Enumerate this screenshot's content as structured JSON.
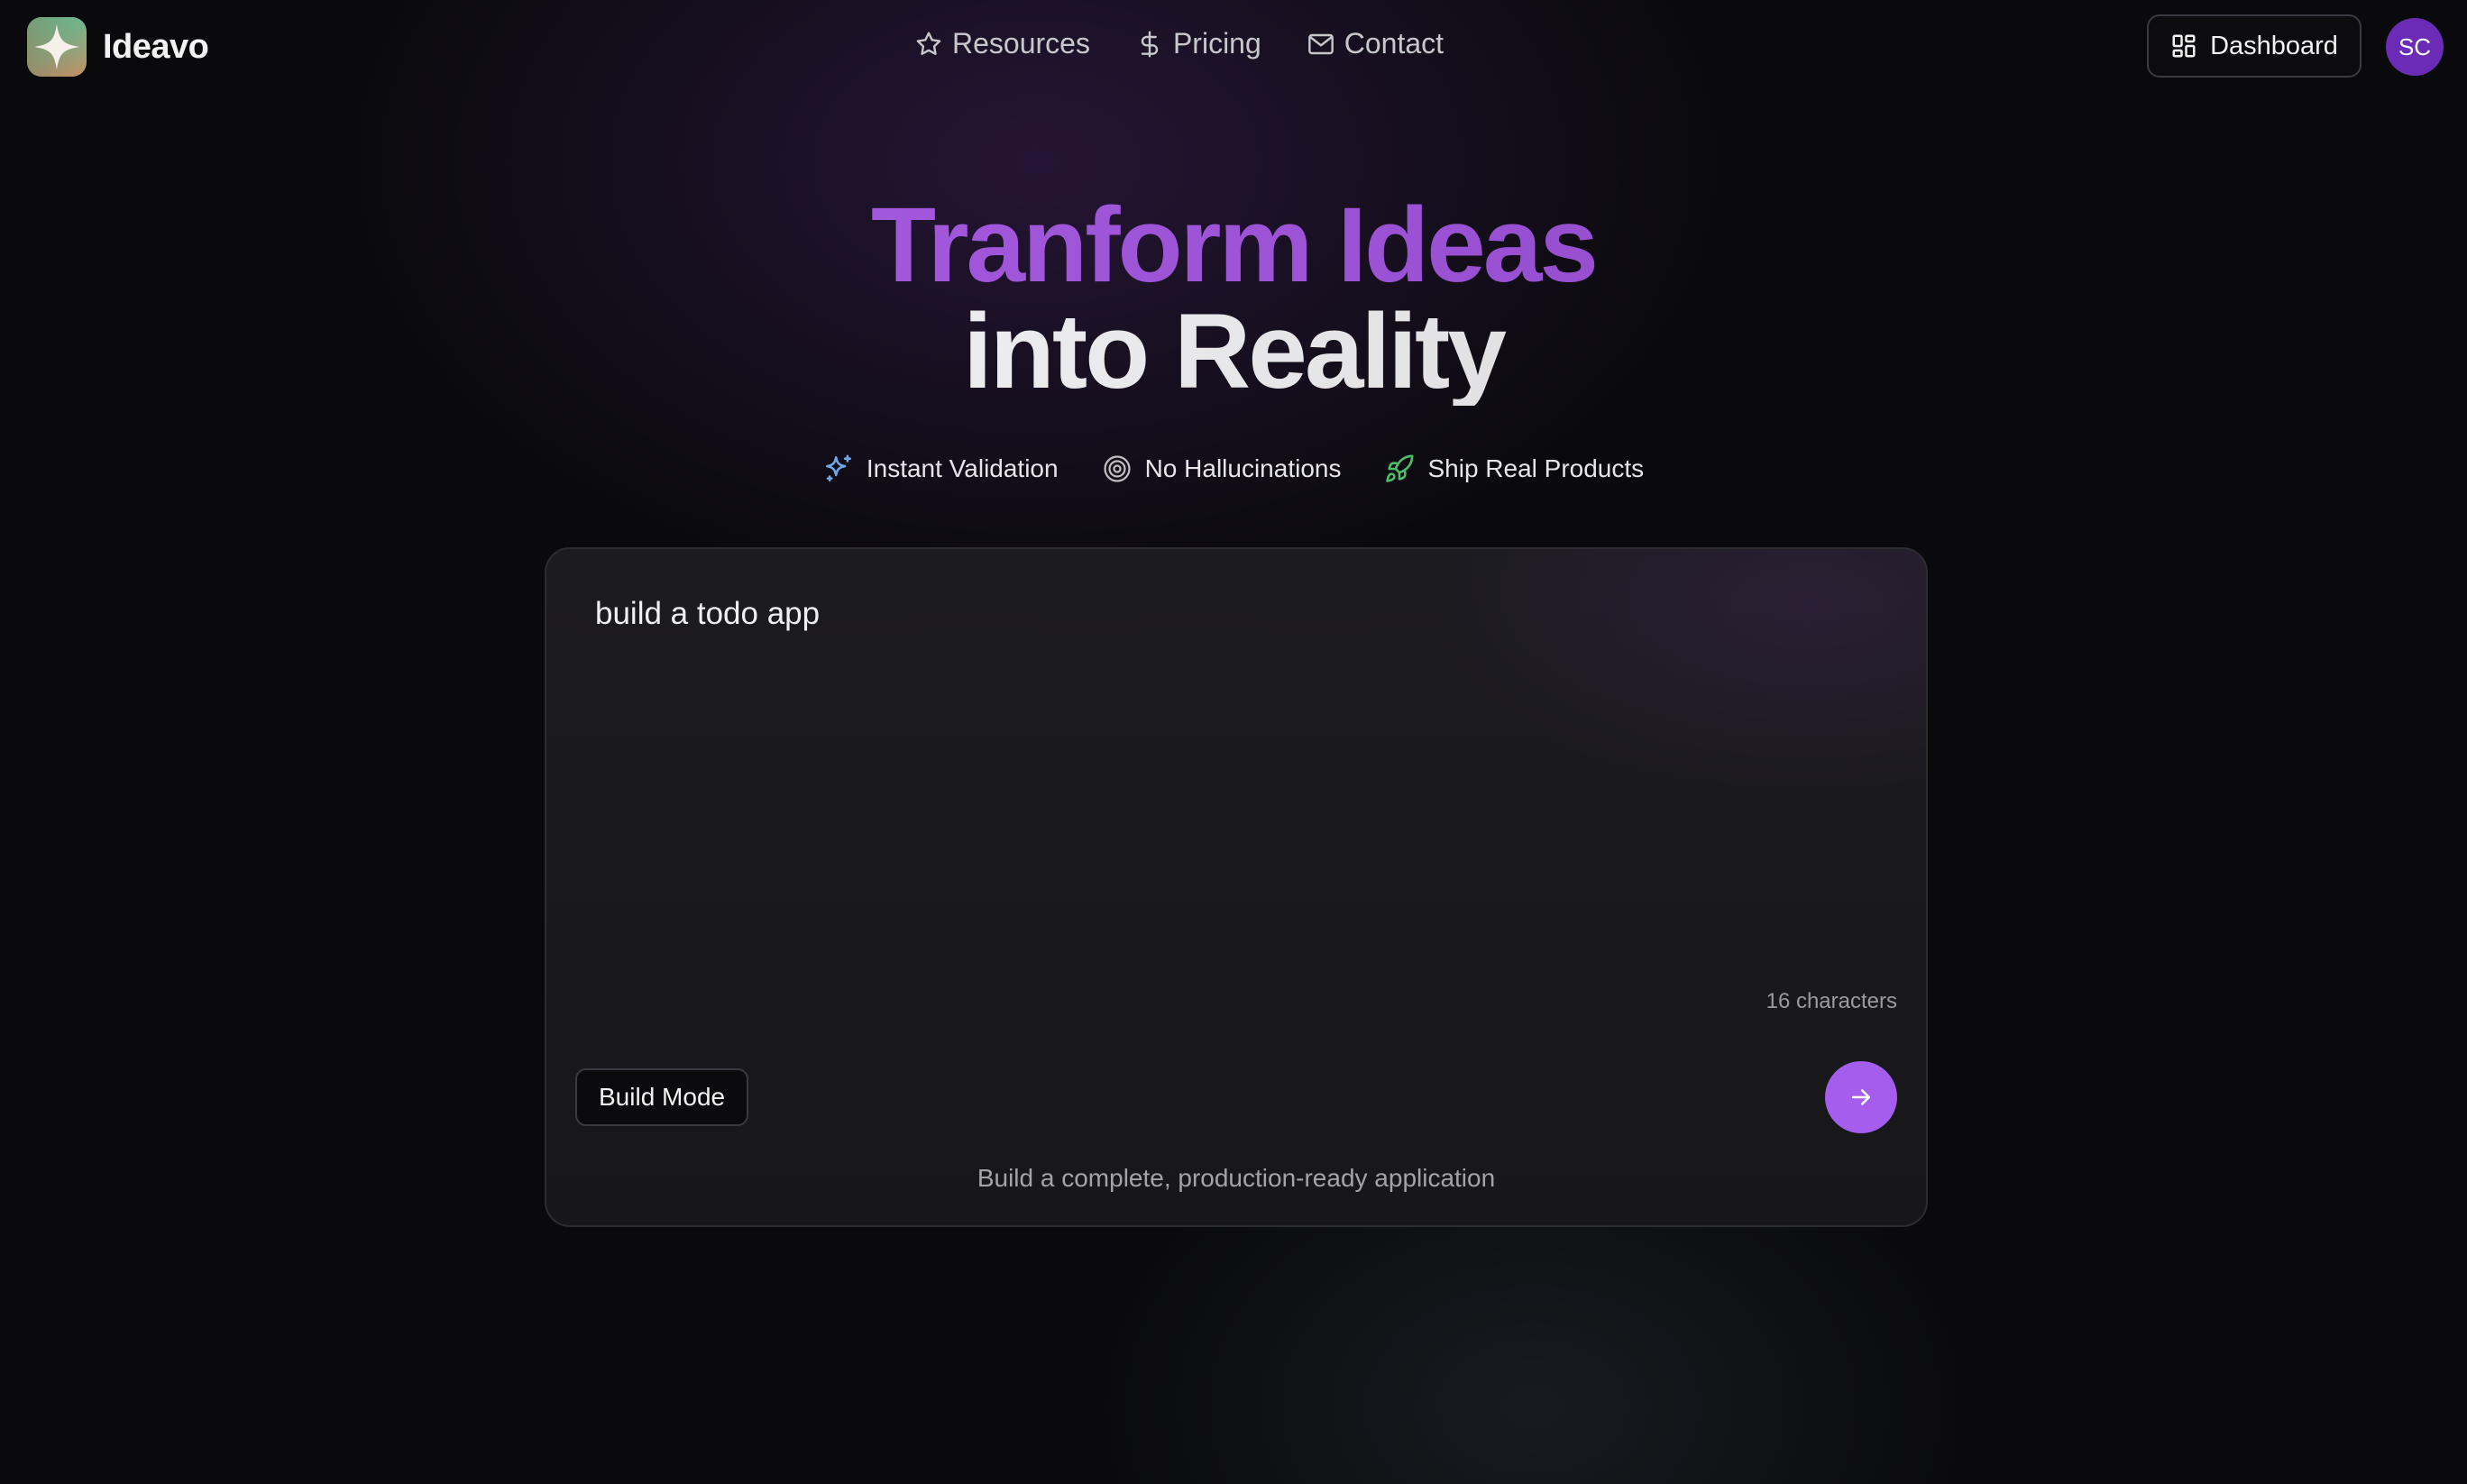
{
  "header": {
    "brand": "Ideavo",
    "nav": [
      {
        "label": "Resources",
        "icon": "star-icon"
      },
      {
        "label": "Pricing",
        "icon": "dollar-icon"
      },
      {
        "label": "Contact",
        "icon": "mail-icon"
      }
    ],
    "dashboard_label": "Dashboard",
    "avatar_initials": "SC"
  },
  "hero": {
    "title_line1": "Tranform Ideas",
    "title_line2": "into Reality"
  },
  "features": [
    {
      "label": "Instant Validation",
      "icon": "sparkle-icon"
    },
    {
      "label": "No Hallucinations",
      "icon": "target-icon"
    },
    {
      "label": "Ship Real Products",
      "icon": "rocket-icon"
    }
  ],
  "prompt_card": {
    "input_value": "build a todo app",
    "char_count": "16 characters",
    "mode_label": "Build Mode",
    "mode_description": "Build a complete, production-ready application"
  },
  "colors": {
    "accent": "#a55ded",
    "avatar": "#6b2bb6",
    "hero_gradient_start": "#b062e8",
    "hero_gradient_end": "#8a45c4"
  }
}
